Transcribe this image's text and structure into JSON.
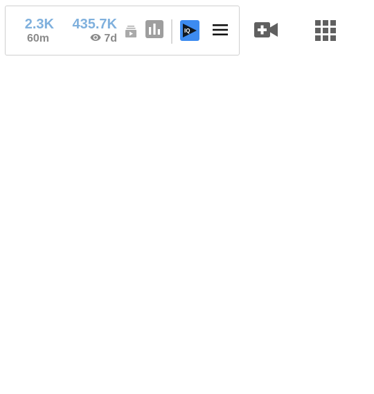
{
  "toolbar": {
    "subscribers": {
      "value": "2.3K",
      "period": "60m"
    },
    "views": {
      "value": "435.7K",
      "period": "7d"
    },
    "icons": {
      "subscriptions": "subscriptions-icon",
      "analytics": "bar-chart-icon",
      "iq": "vidiq-logo-icon",
      "menu": "hamburger-menu-icon",
      "eye": "eye-icon"
    },
    "iq_logo_text": "IQ",
    "colors": {
      "stat_value": "#7fb0dd",
      "stat_sub": "#8a8a8a",
      "iq_accent": "#3d8bf0"
    }
  },
  "header_actions": {
    "create": "video-camera-add-icon",
    "apps": "apps-grid-icon"
  }
}
